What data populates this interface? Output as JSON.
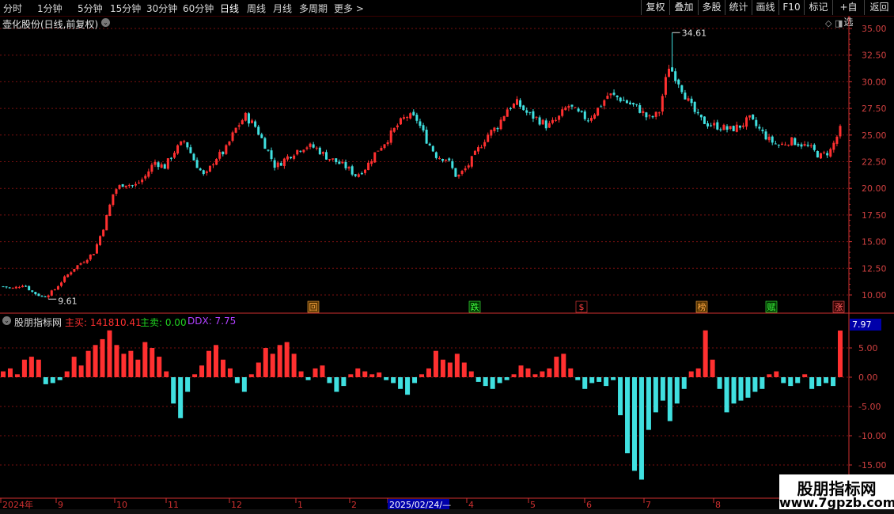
{
  "toolbar": {
    "timeframes": [
      "分时",
      "1分钟",
      "5分钟",
      "15分钟",
      "30分钟",
      "60分钟",
      "日线",
      "周线",
      "月线",
      "多周期",
      "更多 >"
    ],
    "active_timeframe": "日线",
    "right_buttons": [
      "复权",
      "叠加",
      "多股",
      "统计",
      "画线",
      "F10",
      "标记",
      "+自选",
      "返回"
    ]
  },
  "chart": {
    "title": "壶化股份(日线,前复权)",
    "high_label": "34.61",
    "low_label": "9.61",
    "y_ticks": [
      "35.00",
      "32.50",
      "30.00",
      "27.50",
      "25.00",
      "22.50",
      "20.00",
      "17.50",
      "15.00",
      "12.50",
      "10.00"
    ],
    "event_tags": [
      {
        "text": "回",
        "color": "#ffaa44",
        "bg": "#553300"
      },
      {
        "text": "跌",
        "color": "#40ff40",
        "bg": "#003300"
      },
      {
        "text": "$",
        "color": "#ff4040",
        "bg": "#000000"
      },
      {
        "text": "榜",
        "color": "#ffaa44",
        "bg": "#553300"
      },
      {
        "text": "赋",
        "color": "#40ff40",
        "bg": "#003300"
      },
      {
        "text": "涨",
        "color": "#ff6060",
        "bg": "#330000"
      }
    ]
  },
  "indicator": {
    "name": "股朋指标网",
    "buy_label": "主买: 141810.41",
    "sell_label": "主卖: 0.00",
    "ddx_label": "DDX: 7.75",
    "current_value": "7.97",
    "y_ticks": [
      "5.00",
      "0.00",
      "-5.00",
      "-10.00",
      "-15.00"
    ]
  },
  "time_axis": {
    "labels": [
      "2024年",
      "9",
      "10",
      "11",
      "12",
      "1",
      "2",
      "2025/02/24/—",
      "4",
      "5",
      "6",
      "7",
      "8"
    ]
  },
  "brand": {
    "name": "股朋指标网",
    "url": "www.7gpzb.com"
  },
  "colors": {
    "up": "#ff3030",
    "down": "#40e0e0",
    "grid": "#7a1010",
    "axis": "#d03030"
  },
  "chart_data": [
    {
      "type": "candlestick",
      "title": "壶化股份(日线,前复权)",
      "ylim": [
        9,
        36
      ],
      "annotations": [
        {
          "label": "34.61",
          "kind": "high"
        },
        {
          "label": "9.61",
          "kind": "low"
        }
      ],
      "close_trend": [
        10.8,
        10.6,
        11.0,
        10.2,
        9.8,
        10.4,
        11.5,
        12.5,
        13.2,
        14.0,
        16.5,
        19.8,
        20.5,
        20.2,
        21.0,
        22.5,
        22.0,
        23.5,
        24.5,
        22.5,
        21.0,
        22.8,
        23.5,
        25.5,
        26.8,
        25.8,
        24.0,
        22.0,
        22.8,
        23.5,
        24.0,
        23.8,
        23.0,
        22.5,
        22.0,
        21.2,
        22.0,
        23.5,
        24.5,
        25.8,
        26.8,
        26.5,
        24.5,
        23.0,
        22.8,
        21.0,
        22.0,
        23.5,
        25.0,
        25.8,
        27.5,
        28.0,
        27.0,
        26.5,
        25.8,
        26.5,
        27.8,
        27.0,
        26.5,
        27.5,
        28.8,
        28.5,
        28.0,
        27.5,
        26.5,
        27.0,
        31.5,
        30.0,
        28.0,
        26.5,
        26.0,
        25.8,
        25.5,
        25.8,
        26.5,
        25.5,
        24.5,
        24.0,
        24.5,
        24.2,
        23.8,
        23.0,
        23.5,
        25.5
      ]
    },
    {
      "type": "bar",
      "title": "股朋指标网",
      "ylim": [
        -18,
        9
      ],
      "series_name": "DDX",
      "values": [
        1.0,
        1.5,
        0.5,
        3.0,
        3.5,
        3.0,
        -1.2,
        -1.0,
        -0.5,
        1.0,
        3.5,
        2.0,
        4.5,
        5.5,
        6.5,
        8.0,
        5.5,
        4.0,
        4.5,
        3.0,
        6.0,
        5.0,
        3.5,
        1.0,
        -4.5,
        -7.0,
        -2.5,
        0.5,
        2.0,
        4.5,
        5.5,
        3.0,
        1.5,
        -1.0,
        -2.5,
        0.5,
        2.5,
        5.0,
        4.0,
        5.5,
        6.0,
        4.0,
        1.0,
        -0.5,
        1.5,
        2.0,
        -1.0,
        -2.5,
        -1.5,
        0.5,
        1.5,
        1.0,
        0.5,
        0.8,
        -0.5,
        -1.0,
        -2.0,
        -3.0,
        -1.0,
        0.5,
        1.5,
        4.5,
        3.0,
        2.5,
        4.0,
        2.5,
        1.0,
        -0.8,
        -1.5,
        -2.0,
        -1.0,
        -0.5,
        0.5,
        2.0,
        1.5,
        0.5,
        1.0,
        1.5,
        3.5,
        4.0,
        1.5,
        -0.5,
        -2.0,
        -1.0,
        -0.8,
        -1.5,
        -0.5,
        -6.5,
        -13.0,
        -16.0,
        -17.5,
        -9.0,
        -6.0,
        -4.0,
        -7.5,
        -4.5,
        -2.0,
        1.0,
        1.5,
        8.0,
        3.0,
        -2.0,
        -6.0,
        -4.5,
        -4.0,
        -3.5,
        -2.5,
        -2.0,
        0.5,
        1.0,
        -1.0,
        -1.5,
        -1.0,
        0.5,
        -2.0,
        -1.5,
        -1.0,
        -1.5,
        7.97
      ]
    }
  ]
}
